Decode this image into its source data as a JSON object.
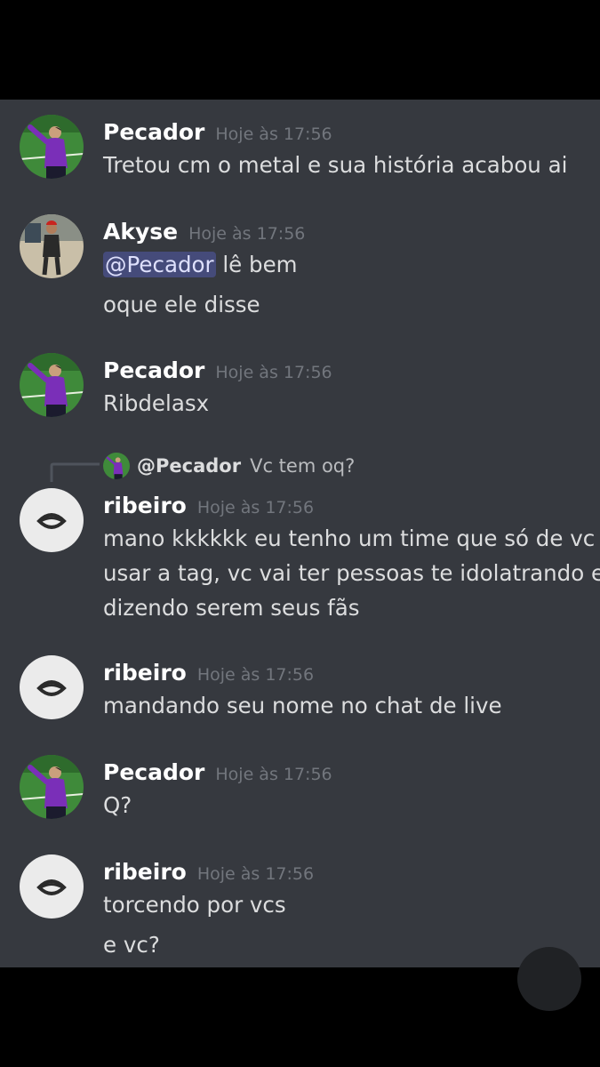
{
  "messages": [
    {
      "author": "Pecador",
      "time": "Hoje às 17:56",
      "lines": [
        "Tretou cm o metal e sua história acabou ai"
      ]
    },
    {
      "author": "Akyse",
      "time": "Hoje às 17:56",
      "mention": "@Pecador",
      "lines": [
        "lê bem",
        "oque ele disse"
      ]
    },
    {
      "author": "Pecador",
      "time": "Hoje às 17:56",
      "lines": [
        "Ribdelasx"
      ]
    },
    {
      "reply": {
        "name": "@Pecador",
        "text": "Vc tem oq?"
      },
      "author": "ribeiro",
      "time": "Hoje às 17:56",
      "lines": [
        "mano kkkkkk eu tenho um time que só de vc",
        "usar a tag, vc vai ter pessoas te idolatrando e",
        "dizendo serem seus fãs"
      ]
    },
    {
      "author": "ribeiro",
      "time": "Hoje às 17:56",
      "lines": [
        "mandando seu nome no chat de live"
      ]
    },
    {
      "author": "Pecador",
      "time": "Hoje às 17:56",
      "lines": [
        "Q?"
      ]
    },
    {
      "author": "ribeiro",
      "time": "Hoje às 17:56",
      "lines": [
        "torcendo por vcs",
        "e vc?"
      ]
    }
  ],
  "colors": {
    "background": "#36393f",
    "author": "#ffffff",
    "timestamp": "#72767d",
    "text": "#dcddde",
    "mention_bg": "#454b7a"
  },
  "icons": {
    "pecador_avatar": "player-photo-avatar",
    "akyse_avatar": "person-photo-avatar",
    "ribeiro_avatar": "eye-icon"
  }
}
